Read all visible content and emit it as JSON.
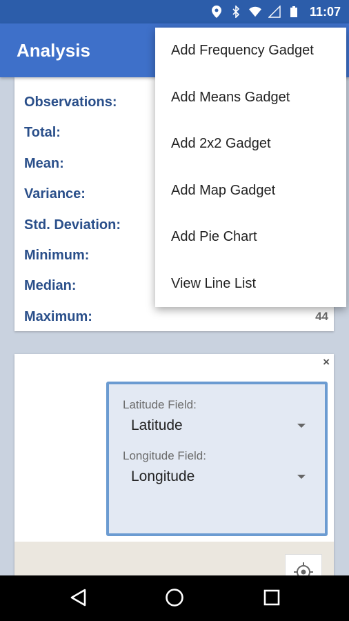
{
  "status_bar": {
    "time": "11:07",
    "icons": [
      "location-icon",
      "bluetooth-icon",
      "wifi-icon",
      "signal-icon",
      "battery-icon"
    ]
  },
  "app_bar": {
    "title": "Analysis"
  },
  "stats": {
    "rows": [
      {
        "label": "Observations:",
        "value": ""
      },
      {
        "label": "Total:",
        "value": ""
      },
      {
        "label": "Mean:",
        "value": ""
      },
      {
        "label": "Variance:",
        "value": ""
      },
      {
        "label": "Std. Deviation:",
        "value": ""
      },
      {
        "label": "Minimum:",
        "value": ""
      },
      {
        "label": "Median:",
        "value": ""
      },
      {
        "label": "Maximum:",
        "value": "44"
      }
    ]
  },
  "map_gadget": {
    "close_label": "×",
    "latitude_label": "Latitude Field:",
    "latitude_value": "Latitude",
    "longitude_label": "Longitude Field:",
    "longitude_value": "Longitude"
  },
  "menu": {
    "items": [
      "Add Frequency Gadget",
      "Add Means Gadget",
      "Add 2x2 Gadget",
      "Add Map Gadget",
      "Add Pie Chart",
      "View Line List"
    ]
  },
  "colors": {
    "status_bar": "#2c5daa",
    "app_bar": "#3e70c9",
    "stat_label": "#2a4f8a",
    "field_box_border": "#6b9bd1"
  }
}
